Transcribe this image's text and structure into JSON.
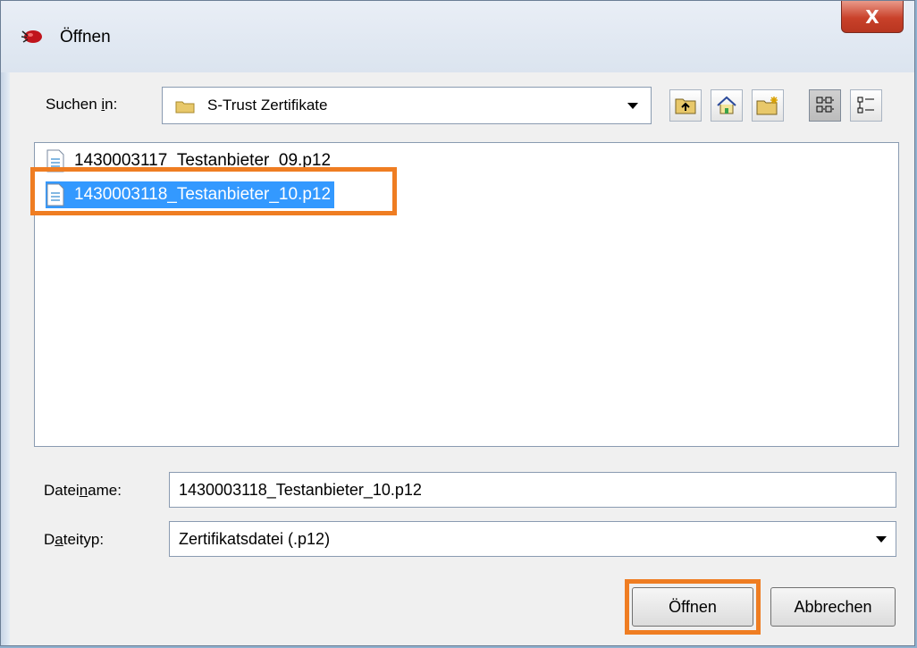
{
  "window": {
    "title": "Öffnen",
    "close_label": "X"
  },
  "lookin": {
    "label_pre": "Suchen ",
    "label_accel": "i",
    "label_post": "n:",
    "value": "S-Trust Zertifikate"
  },
  "toolbar": {
    "buttons": [
      {
        "icon": "up-folder-icon"
      },
      {
        "icon": "home-icon"
      },
      {
        "icon": "new-folder-icon"
      },
      {
        "icon": "list-view-icon",
        "active": true
      },
      {
        "icon": "details-view-icon"
      }
    ]
  },
  "files": [
    {
      "name": "1430003117_Testanbieter_09.p12",
      "selected": false
    },
    {
      "name": "1430003118_Testanbieter_10.p12",
      "selected": true
    }
  ],
  "filename": {
    "label_pre": "Datei",
    "label_accel": "n",
    "label_post": "ame:",
    "value": "1430003118_Testanbieter_10.p12"
  },
  "filetype": {
    "label_pre": "D",
    "label_accel": "a",
    "label_post": "teityp:",
    "value": "Zertifikatsdatei (.p12)"
  },
  "buttons": {
    "open": "Öffnen",
    "cancel": "Abbrechen"
  },
  "colors": {
    "highlight": "#ef7d22",
    "selection": "#3399ff",
    "close": "#c9412a"
  }
}
